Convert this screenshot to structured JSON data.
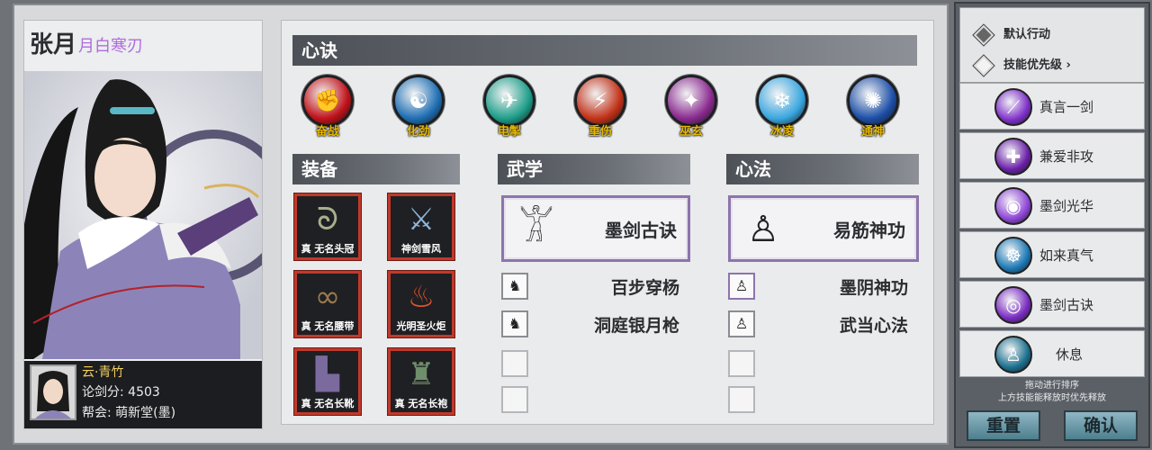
{
  "character": {
    "name": "张月",
    "title": "月白寒刃",
    "title_color": "#b06be0",
    "player_name": "云·青竹",
    "score": "论剑分: 4503",
    "guild": "帮会: 萌新堂(墨)"
  },
  "xinjue": {
    "header": "心诀",
    "skills": [
      {
        "label": "奋战",
        "icon": "fist-icon",
        "color": "#c0131a"
      },
      {
        "label": "化劲",
        "icon": "whirl-figure-icon",
        "color": "#1f6fb4"
      },
      {
        "label": "电掣",
        "icon": "boot-icon",
        "color": "#1e9e8a"
      },
      {
        "label": "重伤",
        "icon": "slash-icon",
        "color": "#c2331a"
      },
      {
        "label": "巫玄",
        "icon": "dagger-icon",
        "color": "#8a2a8f"
      },
      {
        "label": "冰凌",
        "icon": "ice-shard-icon",
        "color": "#3aa7e0"
      },
      {
        "label": "通神",
        "icon": "spirit-icon",
        "color": "#1d4fa8"
      }
    ]
  },
  "equipment": {
    "header": "装备",
    "items": [
      {
        "caption": "真 无名头冠",
        "icon": "headband-icon"
      },
      {
        "caption": "神剑雪风",
        "icon": "sword-icon"
      },
      {
        "caption": "真 无名腰带",
        "icon": "belt-icon"
      },
      {
        "caption": "光明圣火炬",
        "icon": "torch-icon"
      },
      {
        "caption": "真 无名长靴",
        "icon": "boots-icon"
      },
      {
        "caption": "真 无名长袍",
        "icon": "robe-icon"
      }
    ]
  },
  "wuxue": {
    "header": "武学",
    "main": "墨剑古诀",
    "subs": [
      "百步穿杨",
      "洞庭银月枪"
    ]
  },
  "xinfa": {
    "header": "心法",
    "main": "易筋神功",
    "subs": [
      "墨阴神功",
      "武当心法"
    ]
  },
  "priority": {
    "default_action": "默认行动",
    "skill_priority": "技能优先级",
    "items": [
      {
        "label": "真言一剑",
        "icon": "purple-blade-icon",
        "color": "#7e2fc9"
      },
      {
        "label": "兼爱非攻",
        "icon": "purple-sword-icon",
        "color": "#6a1fa8"
      },
      {
        "label": "墨剑光华",
        "icon": "purple-orb-icon",
        "color": "#8e45d6"
      },
      {
        "label": "如来真气",
        "icon": "monk-icon",
        "color": "#1b78b5"
      },
      {
        "label": "墨剑古诀",
        "icon": "purple-swirl-icon",
        "color": "#7a2cc2"
      },
      {
        "label": "休息",
        "icon": "meditate-icon",
        "color": "#1a6f8e"
      }
    ],
    "hint_line1": "拖动进行排序",
    "hint_line2": "上方技能能释放时优先释放",
    "reset_label": "重置",
    "confirm_label": "确认"
  }
}
